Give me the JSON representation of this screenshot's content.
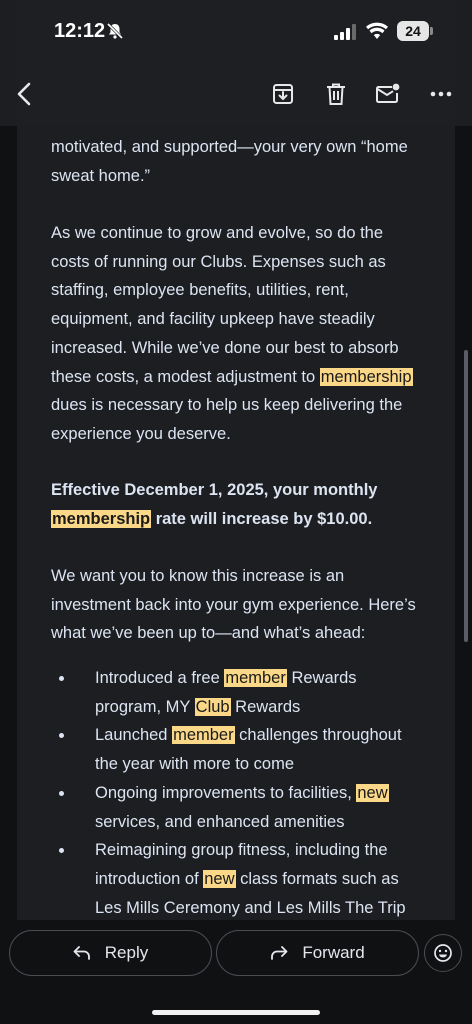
{
  "status": {
    "time": "12:12",
    "battery": "24"
  },
  "email": {
    "ghost_text": "",
    "para1": [
      "motivated, and supported—your very own “home",
      "sweat home.”"
    ],
    "para2": {
      "lines": [
        "As we continue to grow and evolve, so do the",
        "costs of running our Clubs. Expenses such as",
        "staffing, employee benefits, utilities, rent,",
        "equipment, and facility upkeep have steadily",
        "increased. While we’ve done our best to absorb"
      ],
      "l6a": "these costs, a modest adjustment to ",
      "l6hl": "membership",
      "l7": "dues is necessary to help us keep delivering the",
      "l8": "experience you deserve."
    },
    "para3": {
      "l1": "Effective December 1, 2025, your monthly",
      "l2hl": "membership",
      "l2b": " rate will increase by $10.00."
    },
    "para4": [
      "We want you to know this increase is an",
      "investment back into your gym experience. Here’s",
      "what we’ve been up to—and what’s ahead:"
    ],
    "bullets": [
      {
        "a": "Introduced a free ",
        "hl": "member",
        "b": " Rewards",
        "c": "program, MY ",
        "hl2": "Club",
        "d": " Rewards"
      },
      {
        "a": "Launched ",
        "hl": "member",
        "b": " challenges throughout",
        "c": "the year with more to come"
      },
      {
        "a": "Ongoing improvements to facilities, ",
        "hl": "new",
        "b": "",
        "c": "services, and enhanced amenities"
      },
      {
        "a": "Reimagining group fitness, including the",
        "c1": "introduction of ",
        "hl": "new",
        "c2": " class formats such as",
        "d": "Les Mills Ceremony and Les Mills The Trip"
      }
    ]
  },
  "actions": {
    "reply": "Reply",
    "forward": "Forward"
  },
  "colors": {
    "highlight": "#fbd887",
    "background": "#1c1e22"
  }
}
